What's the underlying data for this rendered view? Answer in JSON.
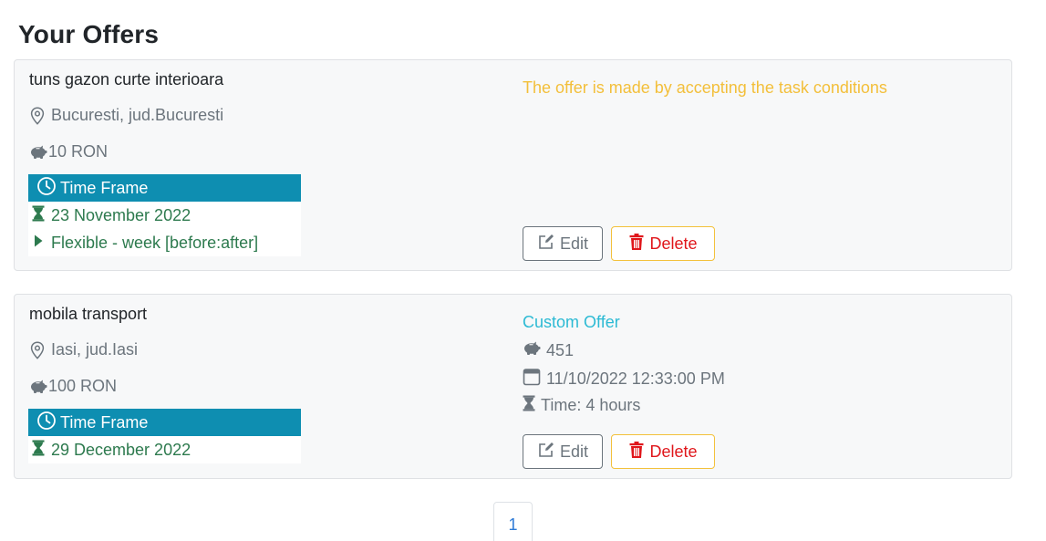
{
  "page": {
    "title": "Your Offers"
  },
  "offers": [
    {
      "task_title": "tuns gazon curte interioara",
      "location": "Bucuresti, jud.Bucuresti",
      "price": "10 RON",
      "time_frame": {
        "header": "Time Frame",
        "date": "23 November 2022",
        "flexibility": "Flexible - week [before:after]"
      },
      "note": "The offer is made by accepting the task conditions",
      "actions": {
        "edit_label": "Edit",
        "delete_label": "Delete"
      }
    },
    {
      "task_title": "mobila transport",
      "location": "Iasi, jud.Iasi",
      "price": "100 RON",
      "time_frame": {
        "header": "Time Frame",
        "date": "29 December 2022"
      },
      "custom_offer": {
        "label": "Custom Offer",
        "amount": "451",
        "datetime": "11/10/2022 12:33:00 PM",
        "duration": "Time: 4 hours"
      },
      "actions": {
        "edit_label": "Edit",
        "delete_label": "Delete"
      }
    }
  ],
  "pagination": {
    "current_page": "1"
  },
  "icons": {
    "location": "geo-alt-icon",
    "price": "piggy-bank-icon",
    "time_frame": "clock-icon",
    "date": "hourglass-icon",
    "flexibility": "caret-right-icon",
    "datetime": "calendar-icon",
    "edit": "pencil-square-icon",
    "delete": "trash-icon"
  },
  "colors": {
    "time_frame_header": "#0e8eb1",
    "time_frame_text": "#2d7a4e",
    "warning_note": "#f3bf3a",
    "custom_offer": "#2cbad4",
    "delete_text": "#e0161b",
    "delete_border": "#f3c13c",
    "pagination_link": "#2d7ad6"
  }
}
